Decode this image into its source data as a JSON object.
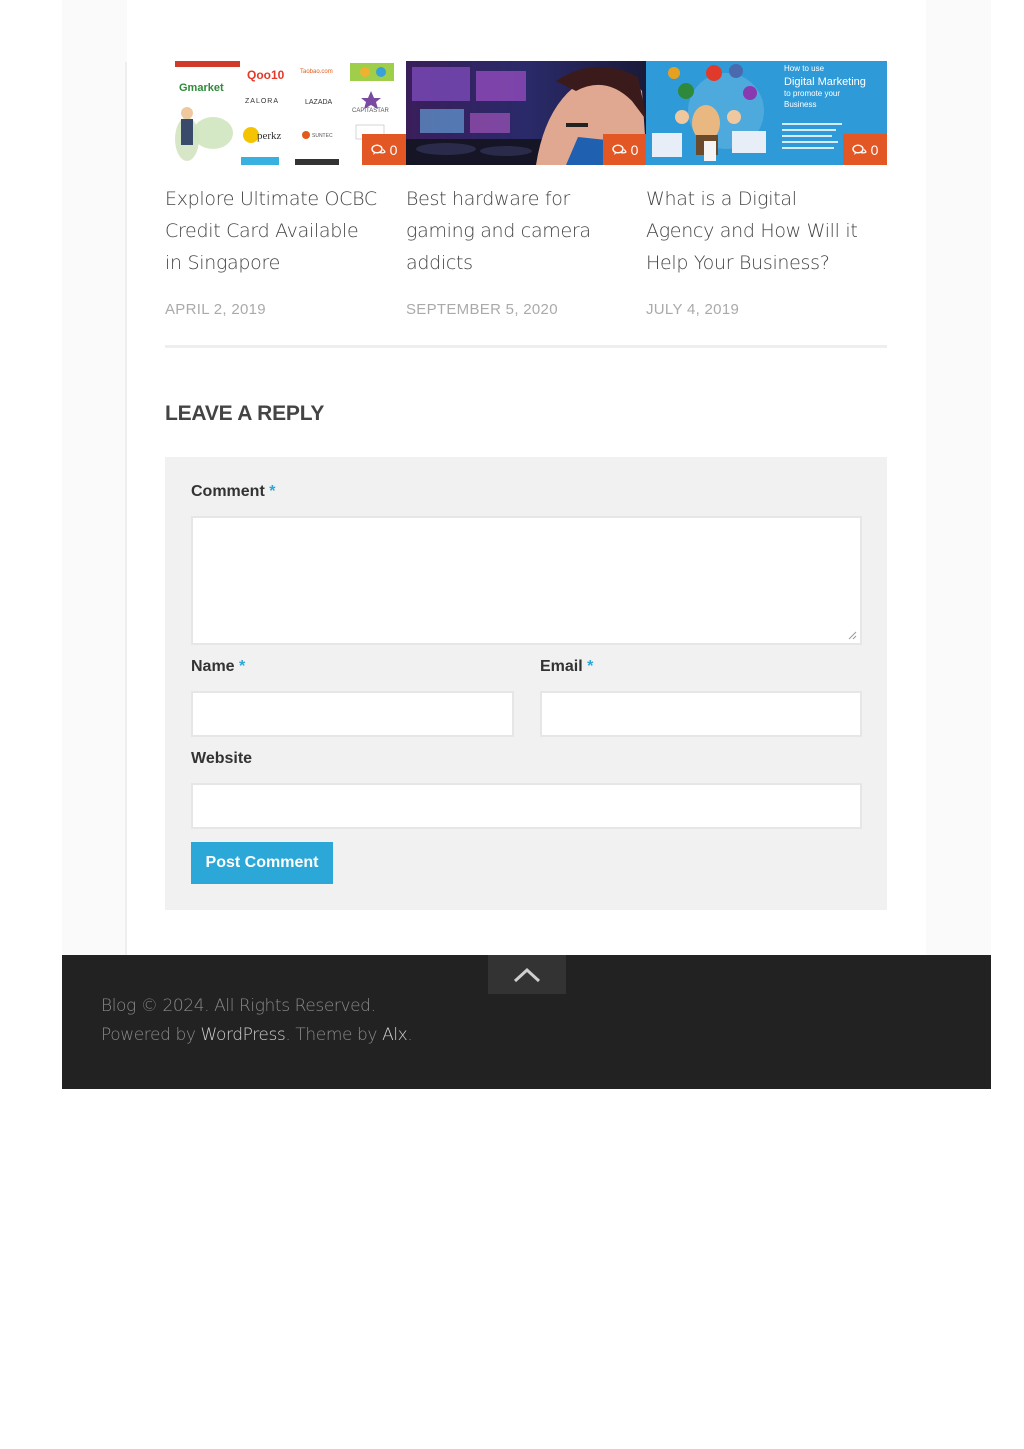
{
  "related_posts": [
    {
      "title": "Explore Ultimate OCBC Credit Card Available in Singapore",
      "date": "APRIL 2, 2019",
      "comments": "0",
      "thumb_text": [
        "Qoo10",
        "Taobao.com",
        "Gmarket",
        "ZALORA",
        "LAZADA",
        "CAPITASTAR",
        "perkz",
        "SUNTEC"
      ]
    },
    {
      "title": "Best hardware for gaming and camera addicts",
      "date": "SEPTEMBER 5, 2020",
      "comments": "0"
    },
    {
      "title": "What is a Digital Agency and How Will it Help Your Business?",
      "date": "JULY 4, 2019",
      "comments": "0",
      "thumb_text": [
        "How to use",
        "Digital Marketing",
        "to promote your",
        "Business"
      ]
    }
  ],
  "reply": {
    "heading": "LEAVE A REPLY",
    "comment_label": "Comment",
    "name_label": "Name",
    "email_label": "Email",
    "website_label": "Website",
    "required_mark": "*",
    "submit_label": "Post Comment"
  },
  "footer": {
    "copyright": "Blog © 2024. All Rights Reserved.",
    "powered_prefix": "Powered by ",
    "wordpress_link": "WordPress",
    "theme_text": ". Theme by ",
    "theme_link": "Alx",
    "end": "."
  },
  "colors": {
    "accent_blue": "#2ba7d8",
    "badge_orange": "#e25724",
    "footer_bg": "#222222"
  },
  "icons": {
    "comment": "speech-bubbles-icon",
    "to_top": "chevron-up-icon"
  }
}
